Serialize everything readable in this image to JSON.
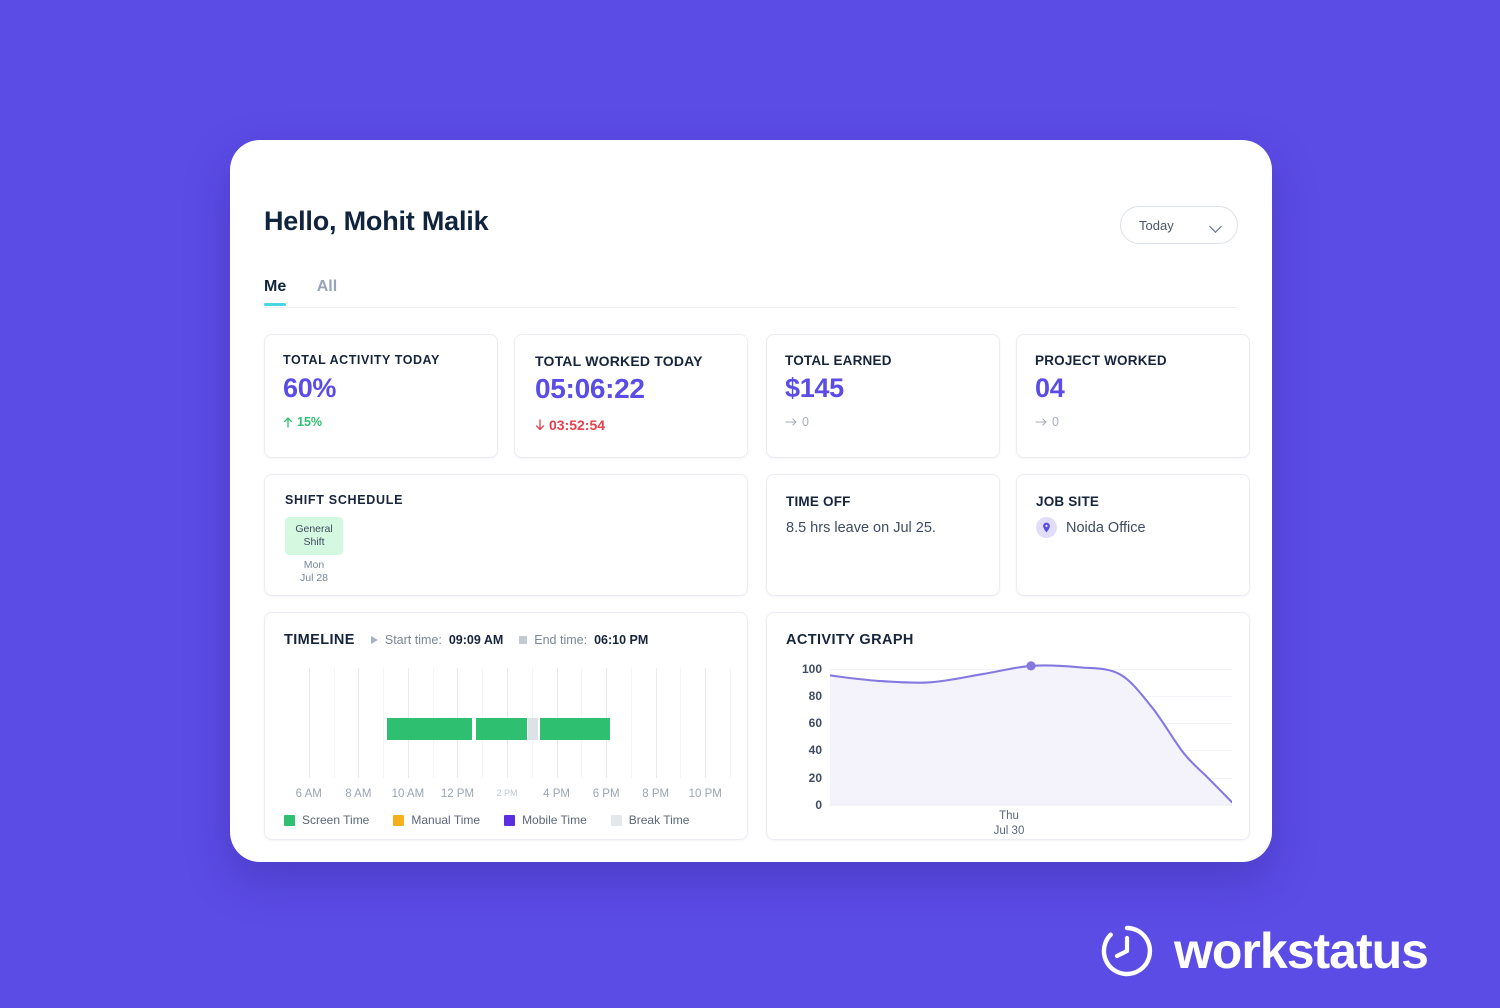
{
  "background_color": "#5B4CE6",
  "accent_color": "#5B4CE6",
  "header": {
    "greeting": "Hello, Mohit Malik",
    "range_selector": {
      "value": "Today",
      "icon": "chevron-down-icon"
    }
  },
  "tabs": [
    {
      "label": "Me",
      "active": true
    },
    {
      "label": "All",
      "active": false
    }
  ],
  "stats": [
    {
      "label": "TOTAL ACTIVITY TODAY",
      "value": "60%",
      "delta": "15%",
      "delta_dir": "up",
      "delta_icon": "arrow-up-icon",
      "delta_color": "#2FBF71"
    },
    {
      "label": "TOTAL WORKED TODAY",
      "value": "05:06:22",
      "delta": "03:52:54",
      "delta_dir": "down",
      "delta_icon": "arrow-down-icon",
      "delta_color": "#E8404A"
    },
    {
      "label": "TOTAL EARNED",
      "value": "$145",
      "delta": "0",
      "delta_dir": "flat",
      "delta_icon": "arrow-right-icon",
      "delta_color": "#A7AEBC"
    },
    {
      "label": "PROJECT WORKED",
      "value": "04",
      "delta": "0",
      "delta_dir": "flat",
      "delta_icon": "arrow-right-icon",
      "delta_color": "#A7AEBC"
    }
  ],
  "shift_schedule": {
    "label": "SHIFT SCHEDULE",
    "badge_line1": "General",
    "badge_line2": "Shift",
    "badge_color": "#D4F8E0",
    "day": "Mon",
    "date": "Jul 28"
  },
  "time_off": {
    "label": "TIME OFF",
    "text": "8.5 hrs leave on Jul 25."
  },
  "job_site": {
    "label": "JOB SITE",
    "icon": "location-pin-icon",
    "name": "Noida Office"
  },
  "timeline": {
    "title": "TIMELINE",
    "start_label": "Start time:",
    "start_value": "09:09 AM",
    "start_icon": "play-icon",
    "end_label": "End time:",
    "end_value": "06:10 PM",
    "end_icon": "stop-icon",
    "legend": [
      {
        "label": "Screen Time",
        "color": "#2FBF71"
      },
      {
        "label": "Manual Time",
        "color": "#F6B118"
      },
      {
        "label": "Mobile Time",
        "color": "#5B2FE0"
      },
      {
        "label": "Break Time",
        "color": "#E4E7EC"
      }
    ]
  },
  "chart_data": [
    {
      "type": "bar",
      "title": "TIMELINE",
      "orientation": "horizontal-timeline",
      "xlabel": "",
      "ylabel": "",
      "xlim": [
        5,
        23
      ],
      "tick_labels": [
        "6 AM",
        "8 AM",
        "10 AM",
        "12 PM",
        "2 PM",
        "4 PM",
        "6 PM",
        "8 PM",
        "10 PM"
      ],
      "tick_hours": [
        6,
        8,
        10,
        12,
        14,
        16,
        18,
        20,
        22
      ],
      "grid": true,
      "segments": [
        {
          "category": "Screen Time",
          "start_hour": 9.15,
          "end_hour": 12.65,
          "color": "#2FBF71"
        },
        {
          "category": "Screen Time",
          "start_hour": 12.75,
          "end_hour": 14.85,
          "color": "#2FBF71"
        },
        {
          "category": "Break Time",
          "start_hour": 14.85,
          "end_hour": 15.3,
          "color": "#DDE1E8"
        },
        {
          "category": "Screen Time",
          "start_hour": 15.35,
          "end_hour": 18.2,
          "color": "#2FBF71"
        }
      ]
    },
    {
      "type": "area",
      "title": "ACTIVITY GRAPH",
      "xlabel": "",
      "ylabel": "",
      "ylim": [
        0,
        100
      ],
      "yticks": [
        0,
        20,
        40,
        60,
        80,
        100
      ],
      "ytick_labels": [
        "0",
        "20",
        "40",
        "60",
        "80",
        "100"
      ],
      "x_tick_labels": [
        "Thu\nJul 30"
      ],
      "x_tick_day": "Thu",
      "x_tick_date": "Jul 30",
      "grid": true,
      "legend": false,
      "line_color": "#8579E0",
      "fill_color": "#F4F3FC",
      "marker": {
        "x": 0.5,
        "y": 102,
        "color": "#8579E0"
      },
      "series": [
        {
          "name": "Activity",
          "x": [
            0,
            0.12,
            0.25,
            0.38,
            0.5,
            0.62,
            0.72,
            0.8,
            0.88,
            0.94,
            1.0
          ],
          "values": [
            95,
            91,
            90,
            96,
            102,
            101,
            96,
            72,
            38,
            20,
            2
          ]
        }
      ]
    }
  ],
  "activity_graph": {
    "title": "ACTIVITY GRAPH"
  },
  "brand": {
    "name": "workstatus",
    "icon": "workstatus-timer-icon"
  }
}
